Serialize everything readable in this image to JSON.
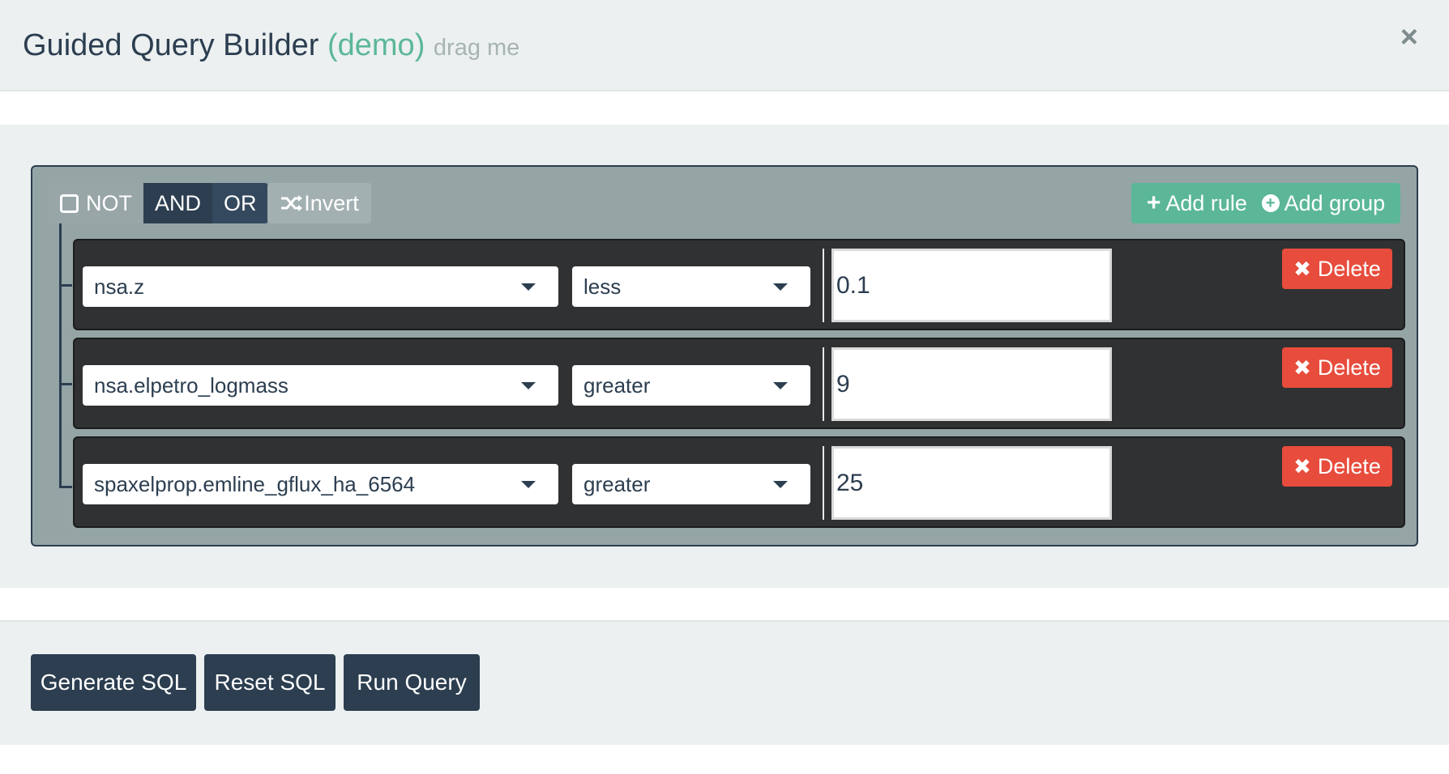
{
  "header": {
    "title": "Guided Query Builder",
    "demo": "(demo)",
    "drag": "drag me",
    "close": "×"
  },
  "group": {
    "not_label": "NOT",
    "and_label": "AND",
    "or_label": "OR",
    "invert_label": "Invert",
    "add_rule_label": "Add rule",
    "add_group_label": "Add group"
  },
  "rules": [
    {
      "field": "nsa.z",
      "operator": "less",
      "value": "0.1",
      "delete_label": "Delete"
    },
    {
      "field": "nsa.elpetro_logmass",
      "operator": "greater",
      "value": "9",
      "delete_label": "Delete"
    },
    {
      "field": "spaxelprop.emline_gflux_ha_6564",
      "operator": "greater",
      "value": "25",
      "delete_label": "Delete"
    }
  ],
  "footer": {
    "generate": "Generate SQL",
    "reset": "Reset SQL",
    "run": "Run Query"
  },
  "colors": {
    "accent_green": "#5bb798",
    "navy": "#2c3e50",
    "delete_red": "#e74c3c",
    "group_bg": "#95a5a6"
  }
}
